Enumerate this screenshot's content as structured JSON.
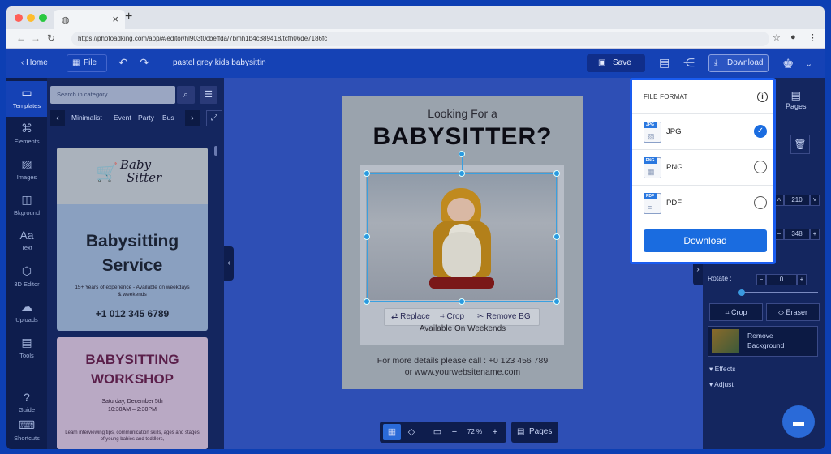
{
  "browser": {
    "tab_icon": "photoadking-icon",
    "url": "https://photoadking.com/app/#/editor/hl903t0cbeffda/7bmh1b4c389418/tcfh06de7186fc"
  },
  "toolbar": {
    "home": "Home",
    "file": "File",
    "doc_name": "pastel grey kids babysitting",
    "save": "Save",
    "download": "Download"
  },
  "sidebar": {
    "items": [
      {
        "label": "Templates",
        "icon": "templates-icon"
      },
      {
        "label": "Elements",
        "icon": "elements-icon"
      },
      {
        "label": "Images",
        "icon": "images-icon"
      },
      {
        "label": "Bkground",
        "icon": "background-icon"
      },
      {
        "label": "Text",
        "icon": "text-icon"
      },
      {
        "label": "3D Editor",
        "icon": "3d-editor-icon"
      },
      {
        "label": "Uploads",
        "icon": "uploads-icon"
      },
      {
        "label": "Tools",
        "icon": "tools-icon"
      },
      {
        "label": "Guide",
        "icon": "guide-icon"
      },
      {
        "label": "Shortcuts",
        "icon": "keyboard-icon"
      }
    ]
  },
  "templates_panel": {
    "search_placeholder": "Search in category",
    "categories": [
      "Minimalist",
      "Event",
      "Party",
      "Bus"
    ],
    "card1": {
      "logo_line1": "Baby",
      "logo_line2": "Sitter",
      "heading1": "Babysitting",
      "heading2": "Service",
      "subtitle": "15+ Years of experience - Available on weekdays & weekends",
      "phone": "+1 012 345 6789"
    },
    "card2": {
      "heading1": "BABYSITTING",
      "heading2": "WORKSHOP",
      "date": "Saturday, December 5th",
      "time": "10:30AM – 2:30PM",
      "desc": "Learn interviewing tips, communication skills, ages and stages of young babies and toddlers,"
    }
  },
  "canvas": {
    "line1": "Looking For a",
    "line2": "BABYSITTER?",
    "context_menu": [
      "Replace",
      "Crop",
      "Remove BG"
    ],
    "line3": "Available On Weekends",
    "line4": "For more details please call : +0 123 456 789",
    "line5": "or www.yourwebsitename.com",
    "zoom": "72 %",
    "pages": "Pages"
  },
  "right_panel": {
    "pages": "Pages",
    "width_value": "210",
    "height_value": "348",
    "rotate_label": "Rotate :",
    "rotate_value": "0",
    "crop": "Crop",
    "eraser": "Eraser",
    "remove_bg_line1": "Remove",
    "remove_bg_line2": "Background",
    "effects": "Effects",
    "adjust": "Adjust"
  },
  "download_menu": {
    "header": "FILE FORMAT",
    "formats": [
      {
        "tag": "JPG",
        "name": "JPG",
        "selected": true
      },
      {
        "tag": "PNG",
        "name": "PNG",
        "selected": false
      },
      {
        "tag": "PDF",
        "name": "PDF",
        "selected": false
      }
    ],
    "button": "Download"
  },
  "colors": {
    "accent": "#1a6ce0",
    "app_bar": "#1542b5",
    "overlay_frame": "#1a5cf0"
  }
}
